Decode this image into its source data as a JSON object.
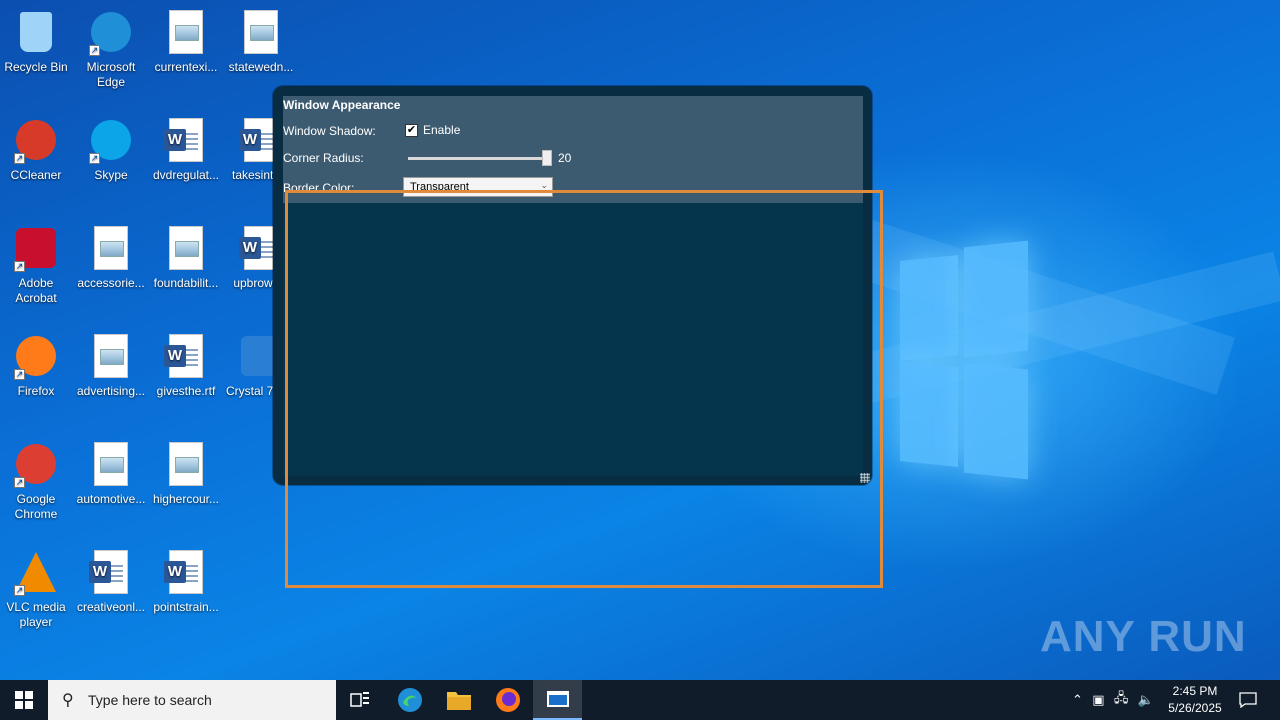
{
  "desktop": {
    "icons": [
      {
        "label": "Recycle Bin",
        "icon": "recycle-bin-icon"
      },
      {
        "label": "Microsoft Edge",
        "icon": "edge-icon"
      },
      {
        "label": "currentexi...",
        "icon": "image-file-icon"
      },
      {
        "label": "statewedn...",
        "icon": "image-file-icon"
      },
      {
        "label": "CCleaner",
        "icon": "ccleaner-icon"
      },
      {
        "label": "Skype",
        "icon": "skype-icon"
      },
      {
        "label": "dvdregulat...",
        "icon": "word-file-icon"
      },
      {
        "label": "takesinte...",
        "icon": "word-file-icon"
      },
      {
        "label": "Adobe Acrobat",
        "icon": "acrobat-icon"
      },
      {
        "label": "accessorie...",
        "icon": "image-file-icon"
      },
      {
        "label": "foundabilit...",
        "icon": "image-file-icon"
      },
      {
        "label": "upbrows...",
        "icon": "word-file-icon"
      },
      {
        "label": "Firefox",
        "icon": "firefox-icon"
      },
      {
        "label": "advertising...",
        "icon": "image-file-icon"
      },
      {
        "label": "givesthe.rtf",
        "icon": "word-file-icon"
      },
      {
        "label": "Crystal 7.exe",
        "icon": "exe-file-icon"
      },
      {
        "label": "Google Chrome",
        "icon": "chrome-icon"
      },
      {
        "label": "automotive...",
        "icon": "image-file-icon"
      },
      {
        "label": "highercour...",
        "icon": "image-file-icon"
      },
      {
        "label": "VLC media player",
        "icon": "vlc-icon"
      },
      {
        "label": "creativeonl...",
        "icon": "word-file-icon"
      },
      {
        "label": "pointstrain...",
        "icon": "word-file-icon"
      }
    ]
  },
  "app_window": {
    "panel_title": "Window Appearance",
    "shadow_label": "Window Shadow:",
    "shadow_checkbox_label": "Enable",
    "shadow_enabled": true,
    "radius_label": "Corner Radius:",
    "radius_value": "20",
    "border_label": "Border Color:",
    "border_value": "Transparent"
  },
  "watermark": "ANY RUN",
  "taskbar": {
    "search_placeholder": "Type here to search",
    "time": "2:45 PM",
    "date": "5/26/2025"
  }
}
